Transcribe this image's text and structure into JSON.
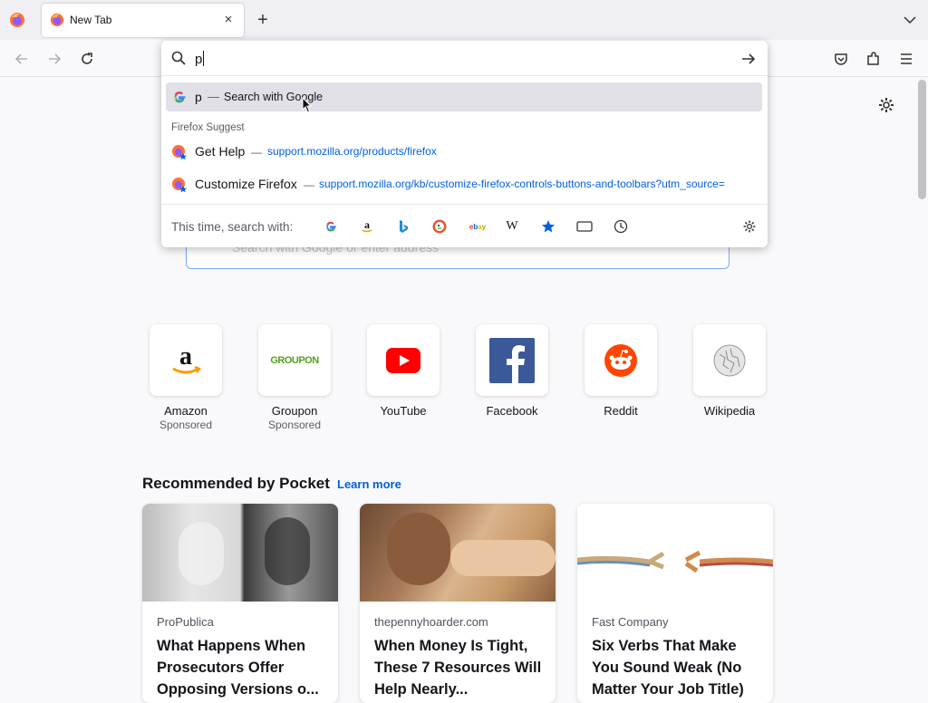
{
  "tab": {
    "title": "New Tab",
    "close": "×"
  },
  "newtab": "+",
  "url": {
    "value": "p"
  },
  "search_result": {
    "query": "p",
    "dash": "—",
    "action": "Search with Google"
  },
  "suggest": {
    "group_label": "Firefox Suggest",
    "items": [
      {
        "title": "Get Help",
        "dash": "—",
        "url": "support.mozilla.org/products/firefox"
      },
      {
        "title": "Customize Firefox",
        "dash": "—",
        "url": "support.mozilla.org/kb/customize-firefox-controls-buttons-and-toolbars?utm_source="
      }
    ]
  },
  "engines": {
    "label": "This time, search with:",
    "list": [
      "google-icon",
      "amazon-icon",
      "bing-icon",
      "duckduckgo-icon",
      "ebay-icon",
      "wikipedia-icon",
      "bookmarks-icon",
      "tabs-icon",
      "history-icon"
    ]
  },
  "home": {
    "search_placeholder": "Search with Google or enter address"
  },
  "topsites": [
    {
      "label": "Amazon",
      "sponsored": "Sponsored"
    },
    {
      "label": "Groupon",
      "sponsored": "Sponsored",
      "logo_text": "GROUPON"
    },
    {
      "label": "YouTube",
      "sponsored": ""
    },
    {
      "label": "Facebook",
      "sponsored": ""
    },
    {
      "label": "Reddit",
      "sponsored": ""
    },
    {
      "label": "Wikipedia",
      "sponsored": ""
    }
  ],
  "pocket": {
    "heading": "Recommended by Pocket",
    "learn_more": "Learn more",
    "cards": [
      {
        "source": "ProPublica",
        "title": "What Happens When Prosecutors Offer Opposing Versions o..."
      },
      {
        "source": "thepennyhoarder.com",
        "title": "When Money Is Tight, These 7 Resources Will Help Nearly..."
      },
      {
        "source": "Fast Company",
        "title": "Six Verbs That Make You Sound Weak (No Matter Your Job Title)"
      }
    ]
  },
  "colors": {
    "accent": "#0061e0",
    "selected_row": "#e0e0e6",
    "tabbar": "#f0f0f4"
  }
}
